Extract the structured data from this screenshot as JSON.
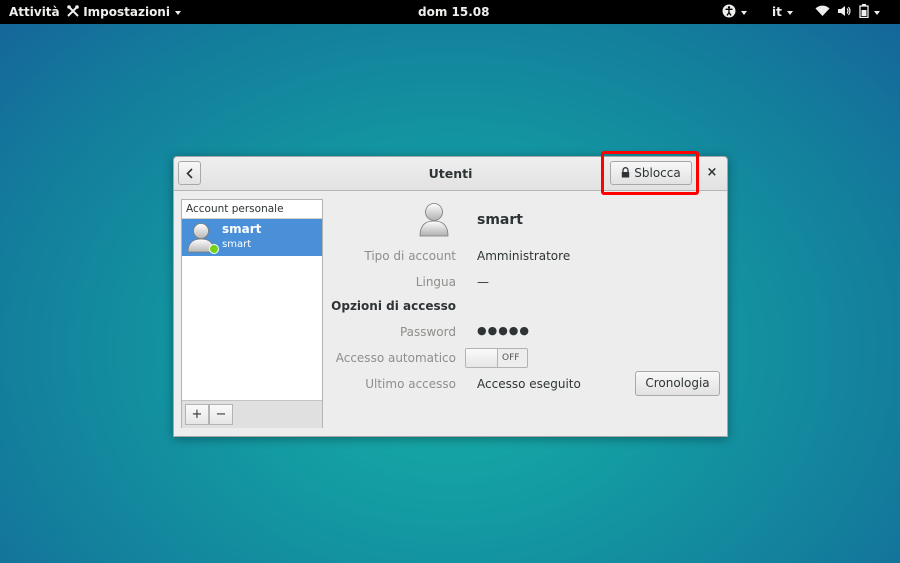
{
  "topbar": {
    "activities": "Attività",
    "app_menu": "Impostazioni",
    "clock": "dom 15.08",
    "language": "it"
  },
  "window": {
    "title": "Utenti",
    "unlock_label": "Sblocca",
    "close_label": "×"
  },
  "panel": {
    "header": "Account personale",
    "user": {
      "name": "smart",
      "login": "smart",
      "status_color": "#73d216"
    },
    "add_label": "+",
    "remove_label": "−"
  },
  "details": {
    "username": "smart",
    "account_type_label": "Tipo di account",
    "account_type_value": "Amministratore",
    "language_label": "Lingua",
    "language_value": "—",
    "access_section": "Opzioni di accesso",
    "password_label": "Password",
    "password_value": "●●●●●",
    "auto_login_label": "Accesso automatico",
    "auto_login_state": "OFF",
    "last_login_label": "Ultimo accesso",
    "last_login_value": "Accesso eseguito",
    "history_button": "Cronologia"
  },
  "colors": {
    "selection": "#4a90d9",
    "highlight_box": "#ff0000",
    "online": "#73d216"
  },
  "icons": [
    "settings-tools-icon",
    "accessibility-icon",
    "wifi-icon",
    "volume-icon",
    "battery-icon",
    "lock-icon",
    "back-arrow-icon",
    "user-avatar-icon"
  ]
}
